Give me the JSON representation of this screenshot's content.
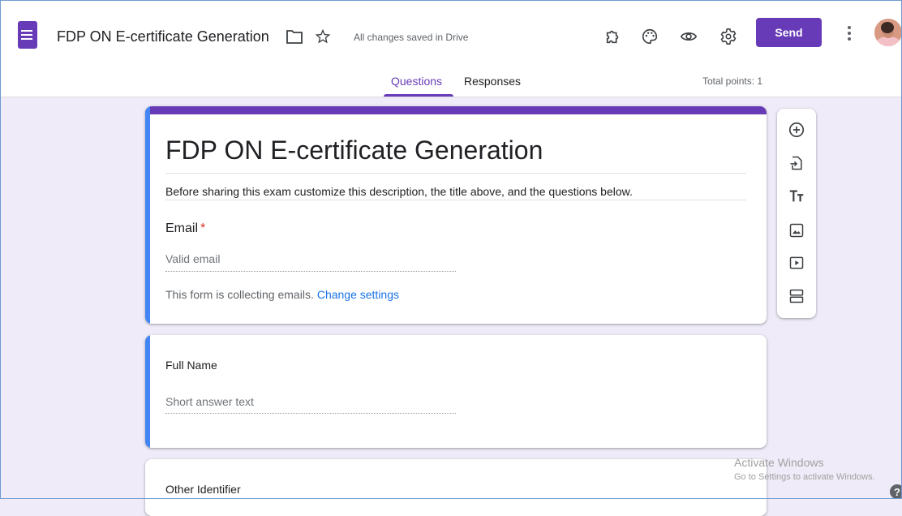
{
  "header": {
    "form_title": "FDP ON E-certificate Generation",
    "save_status": "All changes saved in Drive",
    "send_label": "Send",
    "icons": [
      "forms-app-icon",
      "folder-icon",
      "star-icon",
      "addon-icon",
      "palette-icon",
      "preview-eye-icon",
      "settings-gear-icon",
      "more-vert-icon",
      "avatar"
    ],
    "accent_color": "#673ab7"
  },
  "tabs": {
    "questions": "Questions",
    "responses": "Responses",
    "total_points": "Total points: 1",
    "active": "Questions"
  },
  "title_card": {
    "title": "FDP ON E-certificate Generation",
    "description": "Before sharing this exam customize this description, the title above, and the questions below."
  },
  "email_section": {
    "label": "Email",
    "required_mark": "*",
    "placeholder": "Valid email",
    "collecting_text": "This form is collecting emails.",
    "change_link": "Change settings"
  },
  "questions": [
    {
      "label": "Full Name",
      "placeholder": "Short answer text"
    },
    {
      "label": "Other Identifier"
    }
  ],
  "toolbar": {
    "items": [
      "add-question-icon",
      "import-questions-icon",
      "add-title-icon",
      "add-image-icon",
      "add-video-icon",
      "add-section-icon"
    ]
  },
  "watermark": {
    "title": "Activate Windows",
    "subtitle": "Go to Settings to activate Windows.",
    "help": "?"
  }
}
